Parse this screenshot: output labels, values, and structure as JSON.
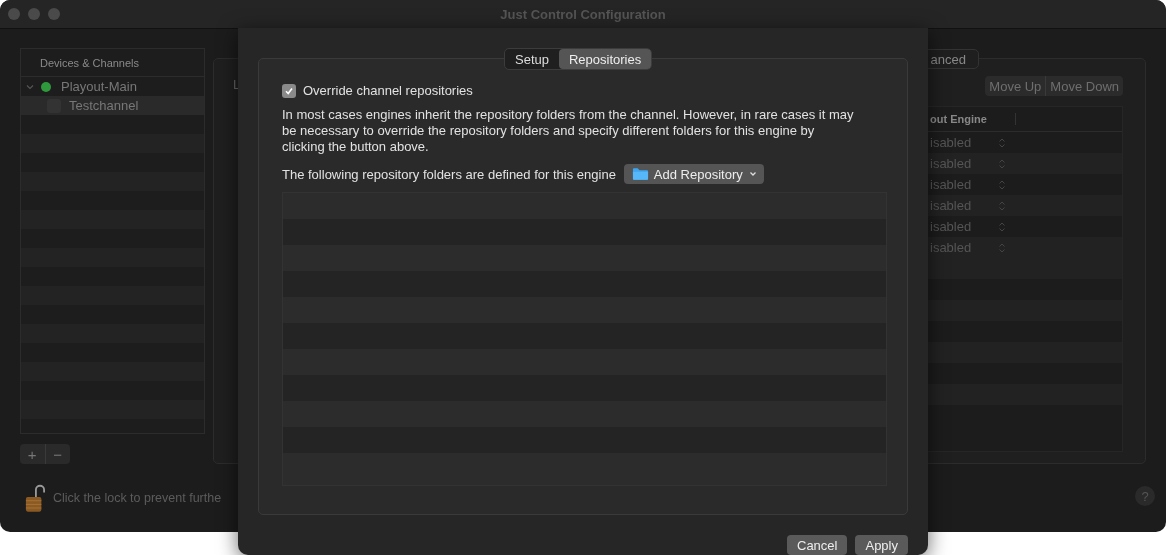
{
  "window": {
    "title": "Just Control Configuration"
  },
  "sidebar": {
    "header": "Devices & Channels",
    "items": [
      {
        "label": "Playout-Main",
        "expanded": true,
        "selected": false,
        "color": "#2f9a3c",
        "children": [
          {
            "label": "Testchannel",
            "selected": true
          }
        ]
      }
    ],
    "buttons": [
      "+",
      "−"
    ]
  },
  "lock_text": "Click the lock to prevent furthe",
  "help": "?",
  "panel": {
    "label_fragment": "L",
    "tab_fragment": "anced",
    "buttons": [
      "Move Up",
      "Move Down"
    ],
    "table": {
      "columns": [
        "out Engine"
      ],
      "rows": [
        "isabled",
        "isabled",
        "isabled",
        "isabled",
        "isabled",
        "isabled"
      ]
    }
  },
  "sheet": {
    "tabs": [
      {
        "label": "Setup",
        "selected": false
      },
      {
        "label": "Repositories",
        "selected": true
      }
    ],
    "override": {
      "label": "Override channel repositories",
      "checked": true
    },
    "description": "In most cases engines inherit the repository folders from the channel. However, in rare cases it may be necessary to override the repository folders and specify different folders for this engine by clicking the button above.",
    "folders_label": "The following repository folders are defined for this engine",
    "add_button": "Add Repository",
    "buttons": [
      "Cancel",
      "Apply"
    ]
  }
}
